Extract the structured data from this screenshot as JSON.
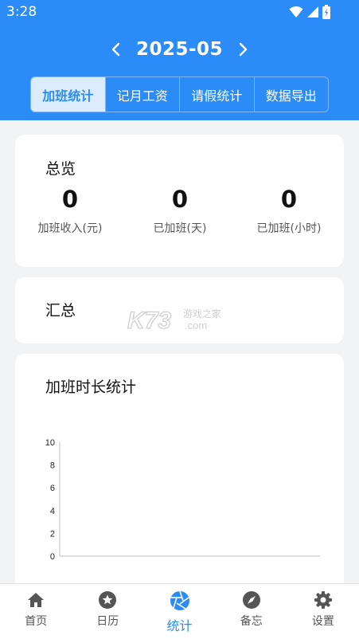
{
  "status_bar": {
    "time": "3:28"
  },
  "header": {
    "month": "2025-05",
    "prev_icon": "chevron-left-icon",
    "next_icon": "chevron-right-icon"
  },
  "tabs": [
    {
      "label": "加班统计",
      "active": true
    },
    {
      "label": "记月工资",
      "active": false
    },
    {
      "label": "请假统计",
      "active": false
    },
    {
      "label": "数据导出",
      "active": false
    }
  ],
  "overview": {
    "title": "总览",
    "stats": [
      {
        "value": "0",
        "label": "加班收入(元)"
      },
      {
        "value": "0",
        "label": "已加班(天)"
      },
      {
        "value": "0",
        "label": "已加班(小时)"
      }
    ]
  },
  "summary": {
    "title": "汇总"
  },
  "watermark": {
    "brand": "K73",
    "line1": "游戏之家",
    "line2": ".com"
  },
  "chart_data": {
    "type": "line",
    "title": "加班时长统计",
    "ylim": [
      0,
      10
    ],
    "yticks": [
      "10",
      "8",
      "6",
      "4",
      "2",
      "0"
    ],
    "series": [],
    "grid": false
  },
  "bottom_nav": [
    {
      "label": "首页",
      "icon": "home-icon",
      "active": false
    },
    {
      "label": "日历",
      "icon": "star-icon",
      "active": false
    },
    {
      "label": "统计",
      "icon": "aperture-icon",
      "active": true
    },
    {
      "label": "备忘",
      "icon": "compass-icon",
      "active": false
    },
    {
      "label": "设置",
      "icon": "gear-icon",
      "active": false
    }
  ],
  "colors": {
    "primary": "#2b8cf7",
    "tab_active_bg": "#dcecfd",
    "background": "#f2f3f5"
  }
}
